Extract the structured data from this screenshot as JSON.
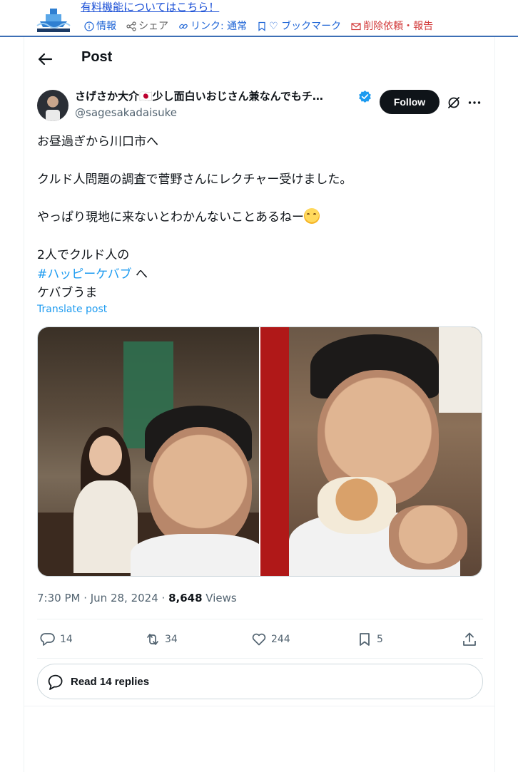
{
  "site": {
    "paid_link": "有料機能についてはこちら！",
    "nav": [
      {
        "icon": "info-icon",
        "label": "情報"
      },
      {
        "icon": "share-icon",
        "label": "シェア"
      },
      {
        "icon": "link-icon",
        "label": "リンク: 通常"
      },
      {
        "icon": "bookmark-icon",
        "label": "♡ ブックマーク"
      },
      {
        "icon": "mail-icon",
        "label": "削除依頼・報告"
      }
    ]
  },
  "header": {
    "title": "Post"
  },
  "author": {
    "name": "さげさか大介🇯🇵少し面白いおじさん兼なんでもチ…",
    "handle": "@sagesakadaisuke",
    "follow_label": "Follow",
    "verified": true
  },
  "tweet": {
    "line1": "お昼過ぎから川口市へ",
    "line2": "クルド人問題の調査で菅野さんにレクチャー受けました。",
    "line3": "やっぱり現地に来ないとわかんないことあるねー",
    "line4": "2人でクルド人の",
    "hashtag": "#ハッピーケバブ",
    "hashtag_suffix": " へ",
    "line5": "ケバブうま",
    "translate": "Translate post"
  },
  "meta": {
    "time": "7:30 PM · Jun 28, 2024 · ",
    "views_count": "8,648",
    "views_label": " Views"
  },
  "actions": {
    "replies": "14",
    "reposts": "34",
    "likes": "244",
    "bookmarks": "5"
  },
  "read_replies": "Read 14 replies",
  "colors": {
    "accent": "#1d9bf0",
    "text": "#0f1419",
    "muted": "#536471",
    "nav_blue": "#1d64d6",
    "nav_red": "#d23b3b"
  }
}
